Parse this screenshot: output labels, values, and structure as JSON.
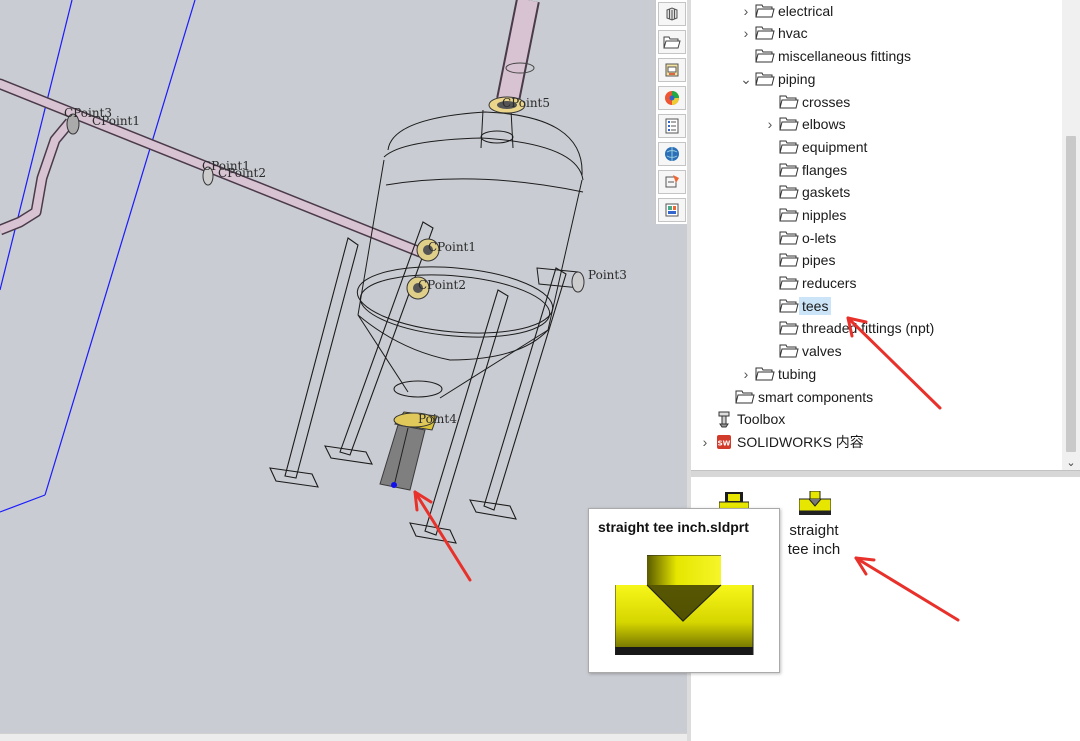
{
  "viewport": {
    "labels": [
      {
        "id": "cpoint3-a",
        "text": "CPoint3"
      },
      {
        "id": "cpoint1-a",
        "text": "CPoint1"
      },
      {
        "id": "cpoint1-b",
        "text": "CPoint1"
      },
      {
        "id": "cpoint2-b",
        "text": "CPoint2"
      },
      {
        "id": "cpoint5",
        "text": "CPoint5"
      },
      {
        "id": "cpoint1-c",
        "text": "CPoint1"
      },
      {
        "id": "cpoint2-c",
        "text": "CPoint2"
      },
      {
        "id": "cpoint3-c",
        "text": "Point3"
      },
      {
        "id": "cpoint4",
        "text": "Point4"
      }
    ]
  },
  "side_tabs": [
    {
      "icon": "parts-icon"
    },
    {
      "icon": "design-library-icon"
    },
    {
      "icon": "file-explorer-icon"
    },
    {
      "icon": "appearances-icon"
    },
    {
      "icon": "custom-properties-icon"
    },
    {
      "icon": "3d-content-central-icon"
    },
    {
      "icon": "solidworks-resources-icon"
    },
    {
      "icon": "view-palette-icon"
    }
  ],
  "tree": {
    "items": [
      {
        "label": "electrical",
        "level": 1,
        "chevron": "right",
        "icon": "folder-icon"
      },
      {
        "label": "hvac",
        "level": 1,
        "chevron": "right",
        "icon": "folder-icon"
      },
      {
        "label": "miscellaneous fittings",
        "level": 1,
        "chevron": "",
        "icon": "folder-icon"
      },
      {
        "label": "piping",
        "level": 1,
        "chevron": "down",
        "icon": "folder-icon"
      },
      {
        "label": "crosses",
        "level": 2,
        "chevron": "",
        "icon": "folder-icon"
      },
      {
        "label": "elbows",
        "level": 2,
        "chevron": "right",
        "icon": "folder-icon"
      },
      {
        "label": "equipment",
        "level": 2,
        "chevron": "",
        "icon": "folder-icon"
      },
      {
        "label": "flanges",
        "level": 2,
        "chevron": "",
        "icon": "folder-icon"
      },
      {
        "label": "gaskets",
        "level": 2,
        "chevron": "",
        "icon": "folder-icon"
      },
      {
        "label": "nipples",
        "level": 2,
        "chevron": "",
        "icon": "folder-icon"
      },
      {
        "label": "o-lets",
        "level": 2,
        "chevron": "",
        "icon": "folder-icon"
      },
      {
        "label": "pipes",
        "level": 2,
        "chevron": "",
        "icon": "folder-icon"
      },
      {
        "label": "reducers",
        "level": 2,
        "chevron": "",
        "icon": "folder-icon"
      },
      {
        "label": "tees",
        "level": 2,
        "chevron": "",
        "icon": "folder-icon",
        "selected": true
      },
      {
        "label": "threaded fittings (npt)",
        "level": 2,
        "chevron": "",
        "icon": "folder-icon"
      },
      {
        "label": "valves",
        "level": 2,
        "chevron": "",
        "icon": "folder-icon"
      },
      {
        "label": "tubing",
        "level": 1,
        "chevron": "right",
        "icon": "folder-icon"
      },
      {
        "label": "smart components",
        "level": 0,
        "chevron": "",
        "icon": "folder-icon"
      },
      {
        "label": "Toolbox",
        "level": -1,
        "chevron": "",
        "icon": "toolbox-icon"
      },
      {
        "label": "SOLIDWORKS 内容",
        "level": -1,
        "chevron": "right",
        "icon": "solidworks-content-icon"
      }
    ]
  },
  "files": {
    "items": [
      {
        "caption": "straight\ntee inch",
        "icon": "straight-tee-part-icon"
      }
    ]
  },
  "tooltip": {
    "title": "straight tee inch.sldprt"
  },
  "colors": {
    "viewport_bg": "#c9ccd2",
    "selection": "#cce4f7",
    "annotation_arrow": "#e8312a",
    "part_yellow": "#e6e600"
  }
}
